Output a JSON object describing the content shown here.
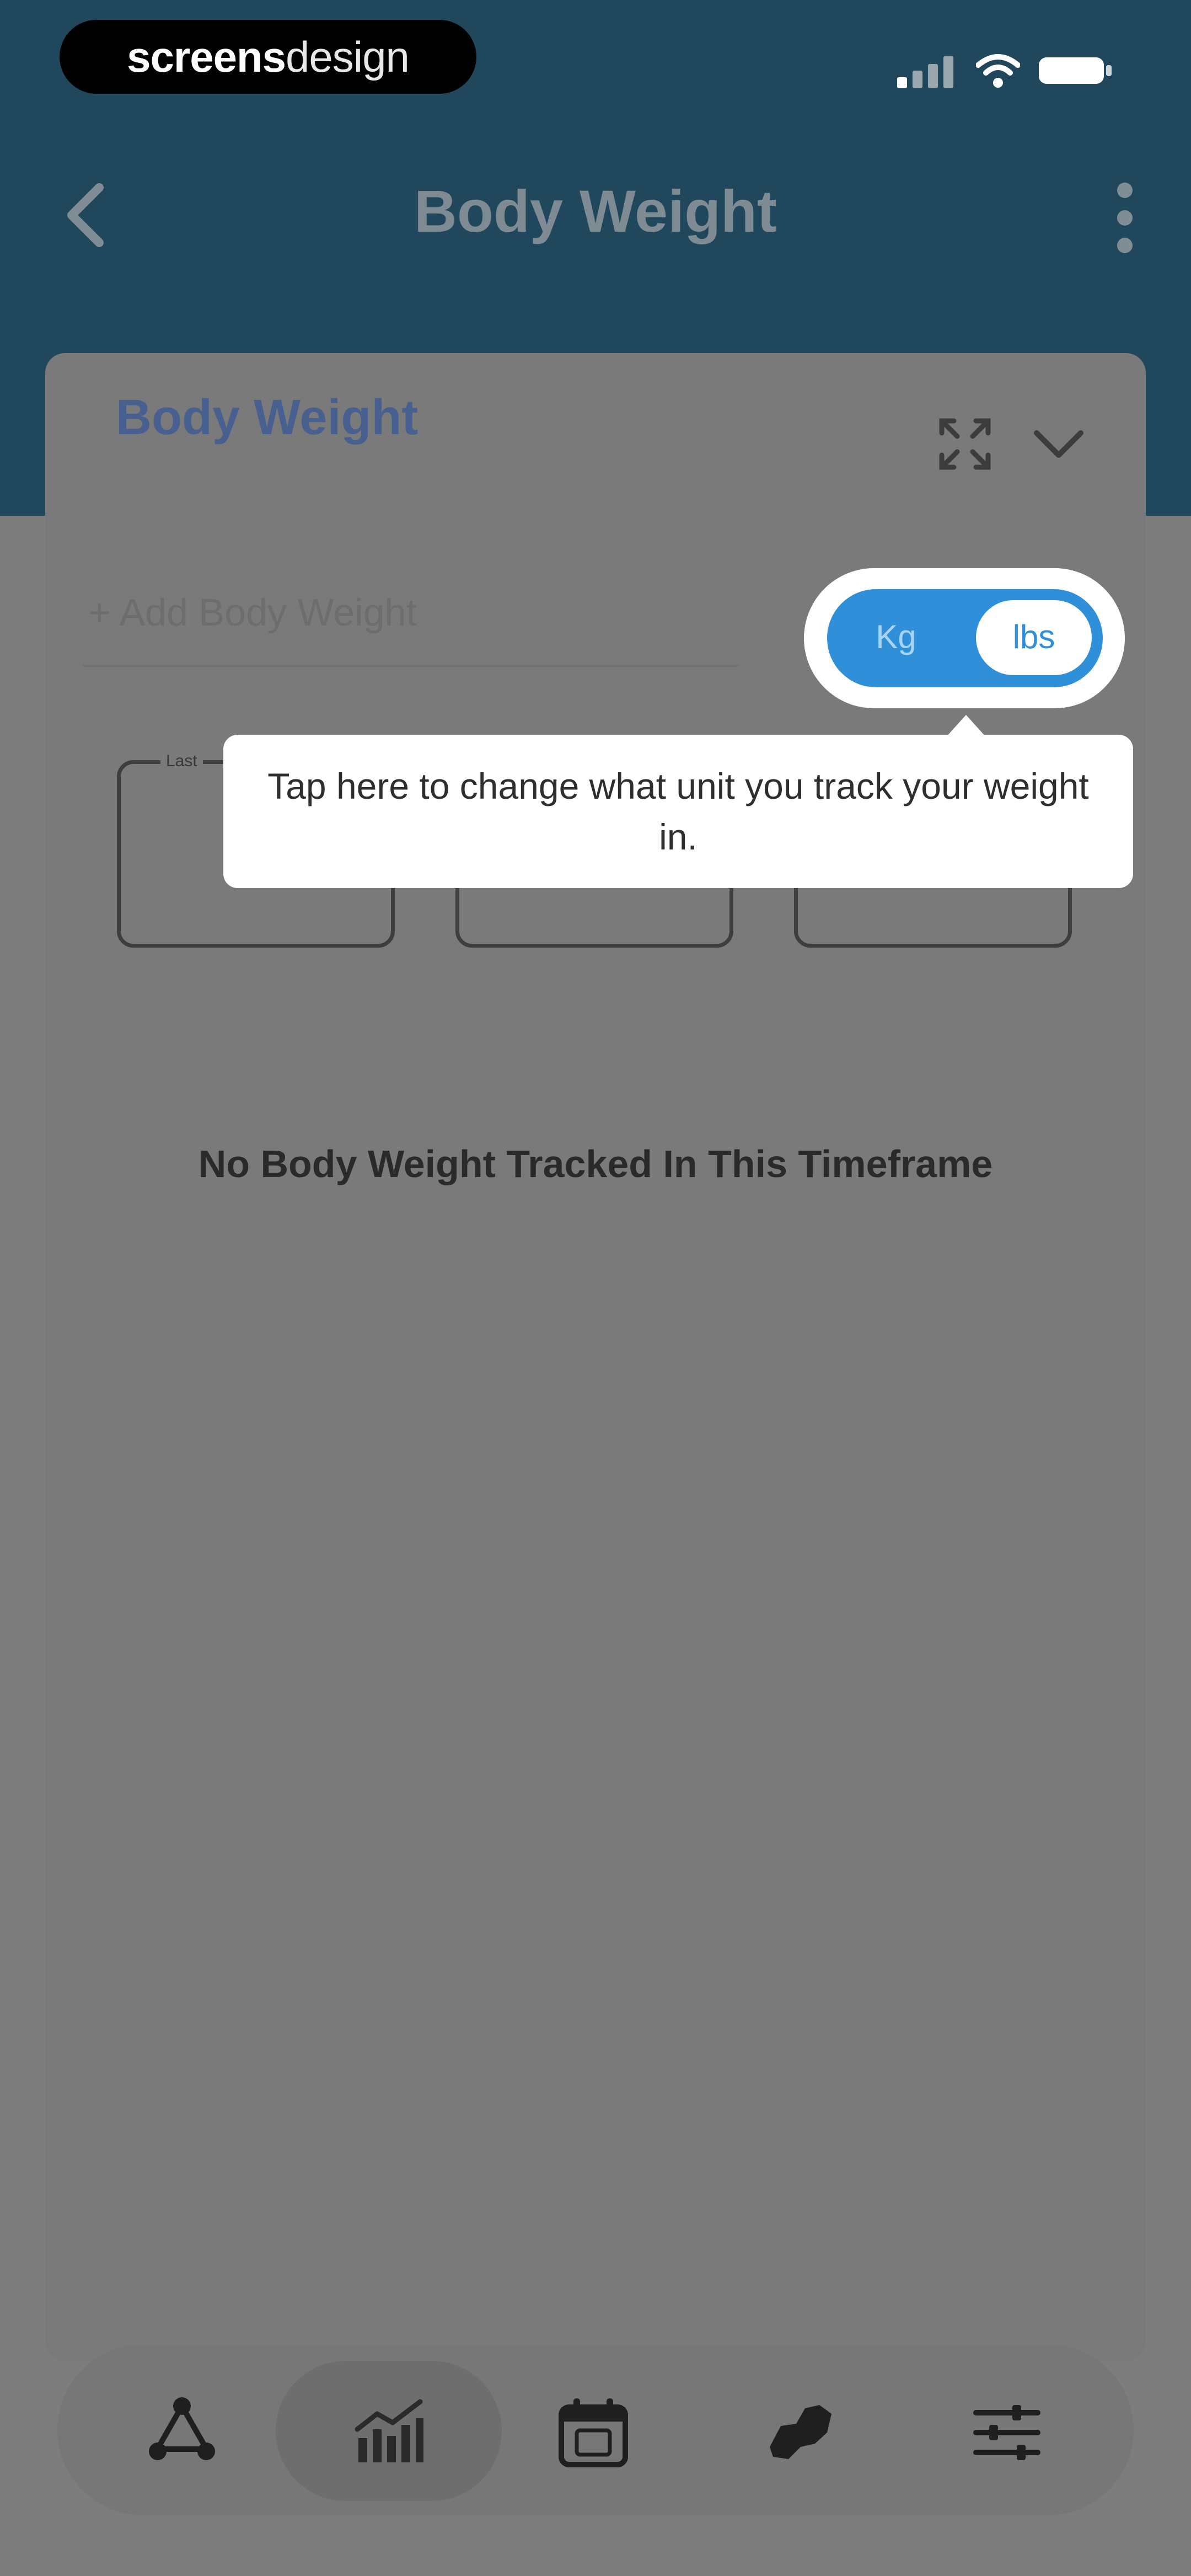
{
  "brand": {
    "part1": "screens",
    "part2": "design"
  },
  "header": {
    "title": "Body Weight"
  },
  "card": {
    "title": "Body Weight",
    "add_label": "+ Add Body Weight",
    "stat_label": "Last"
  },
  "unit_toggle": {
    "option_kg": "Kg",
    "option_lbs": "lbs",
    "selected": "lbs"
  },
  "tooltip": {
    "text": "Tap here to change what unit you track your weight in."
  },
  "empty_state": {
    "text": "No Body Weight Tracked In This Timeframe"
  },
  "nav": {
    "items": [
      {
        "icon": "workouts-cycle-icon"
      },
      {
        "icon": "stats-chart-icon",
        "active": true
      },
      {
        "icon": "calendar-icon"
      },
      {
        "icon": "body-map-icon"
      },
      {
        "icon": "settings-sliders-icon"
      }
    ]
  },
  "colors": {
    "header_bg": "#21475d",
    "accent": "#2f8fd8",
    "overlay_bg": "#7d7d7d",
    "card_title": "#47608f"
  }
}
